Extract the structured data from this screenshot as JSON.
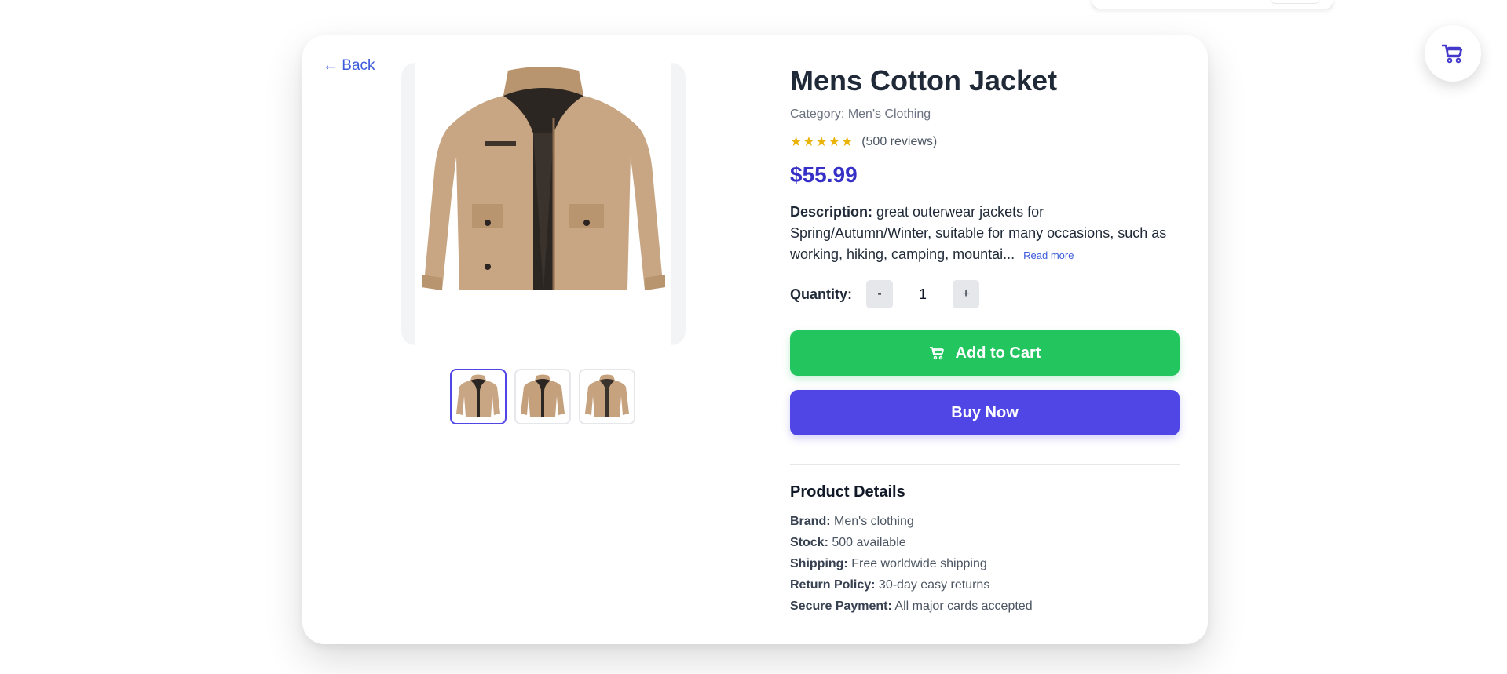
{
  "nav": {
    "back_label": "← Back"
  },
  "product": {
    "title": "Mens Cotton Jacket",
    "category": "Category: Men's Clothing",
    "stars": "★★★★★",
    "rating": 5,
    "reviews": "(500 reviews)",
    "price": "$55.99",
    "description_label": "Description:",
    "description_text": " great outerwear jackets for Spring/Autumn/Winter, suitable for many occasions, such as working, hiking, camping, mountai...",
    "read_more": "Read more",
    "image_thumbnails": 3,
    "active_thumbnail": 1
  },
  "quantity": {
    "label": "Quantity:",
    "decrement": "-",
    "value": "1",
    "increment": "+"
  },
  "actions": {
    "add_to_cart": "Add to Cart",
    "buy_now": "Buy Now"
  },
  "details": {
    "title": "Product Details",
    "rows": [
      {
        "key": "Brand:",
        "value": " Men's clothing"
      },
      {
        "key": "Stock:",
        "value": " 500 available"
      },
      {
        "key": "Shipping:",
        "value": " Free worldwide shipping"
      },
      {
        "key": "Return Policy:",
        "value": " 30-day easy returns"
      },
      {
        "key": "Secure Payment:",
        "value": " All major cards accepted"
      }
    ]
  },
  "icons": {
    "cart": "cart-icon",
    "floating_cart": "cart-icon"
  },
  "colors": {
    "accent": "#4f46e5",
    "price": "#3730c7",
    "add_to_cart": "#22c55e",
    "stars": "#eab308",
    "link": "#3b5bdb"
  }
}
